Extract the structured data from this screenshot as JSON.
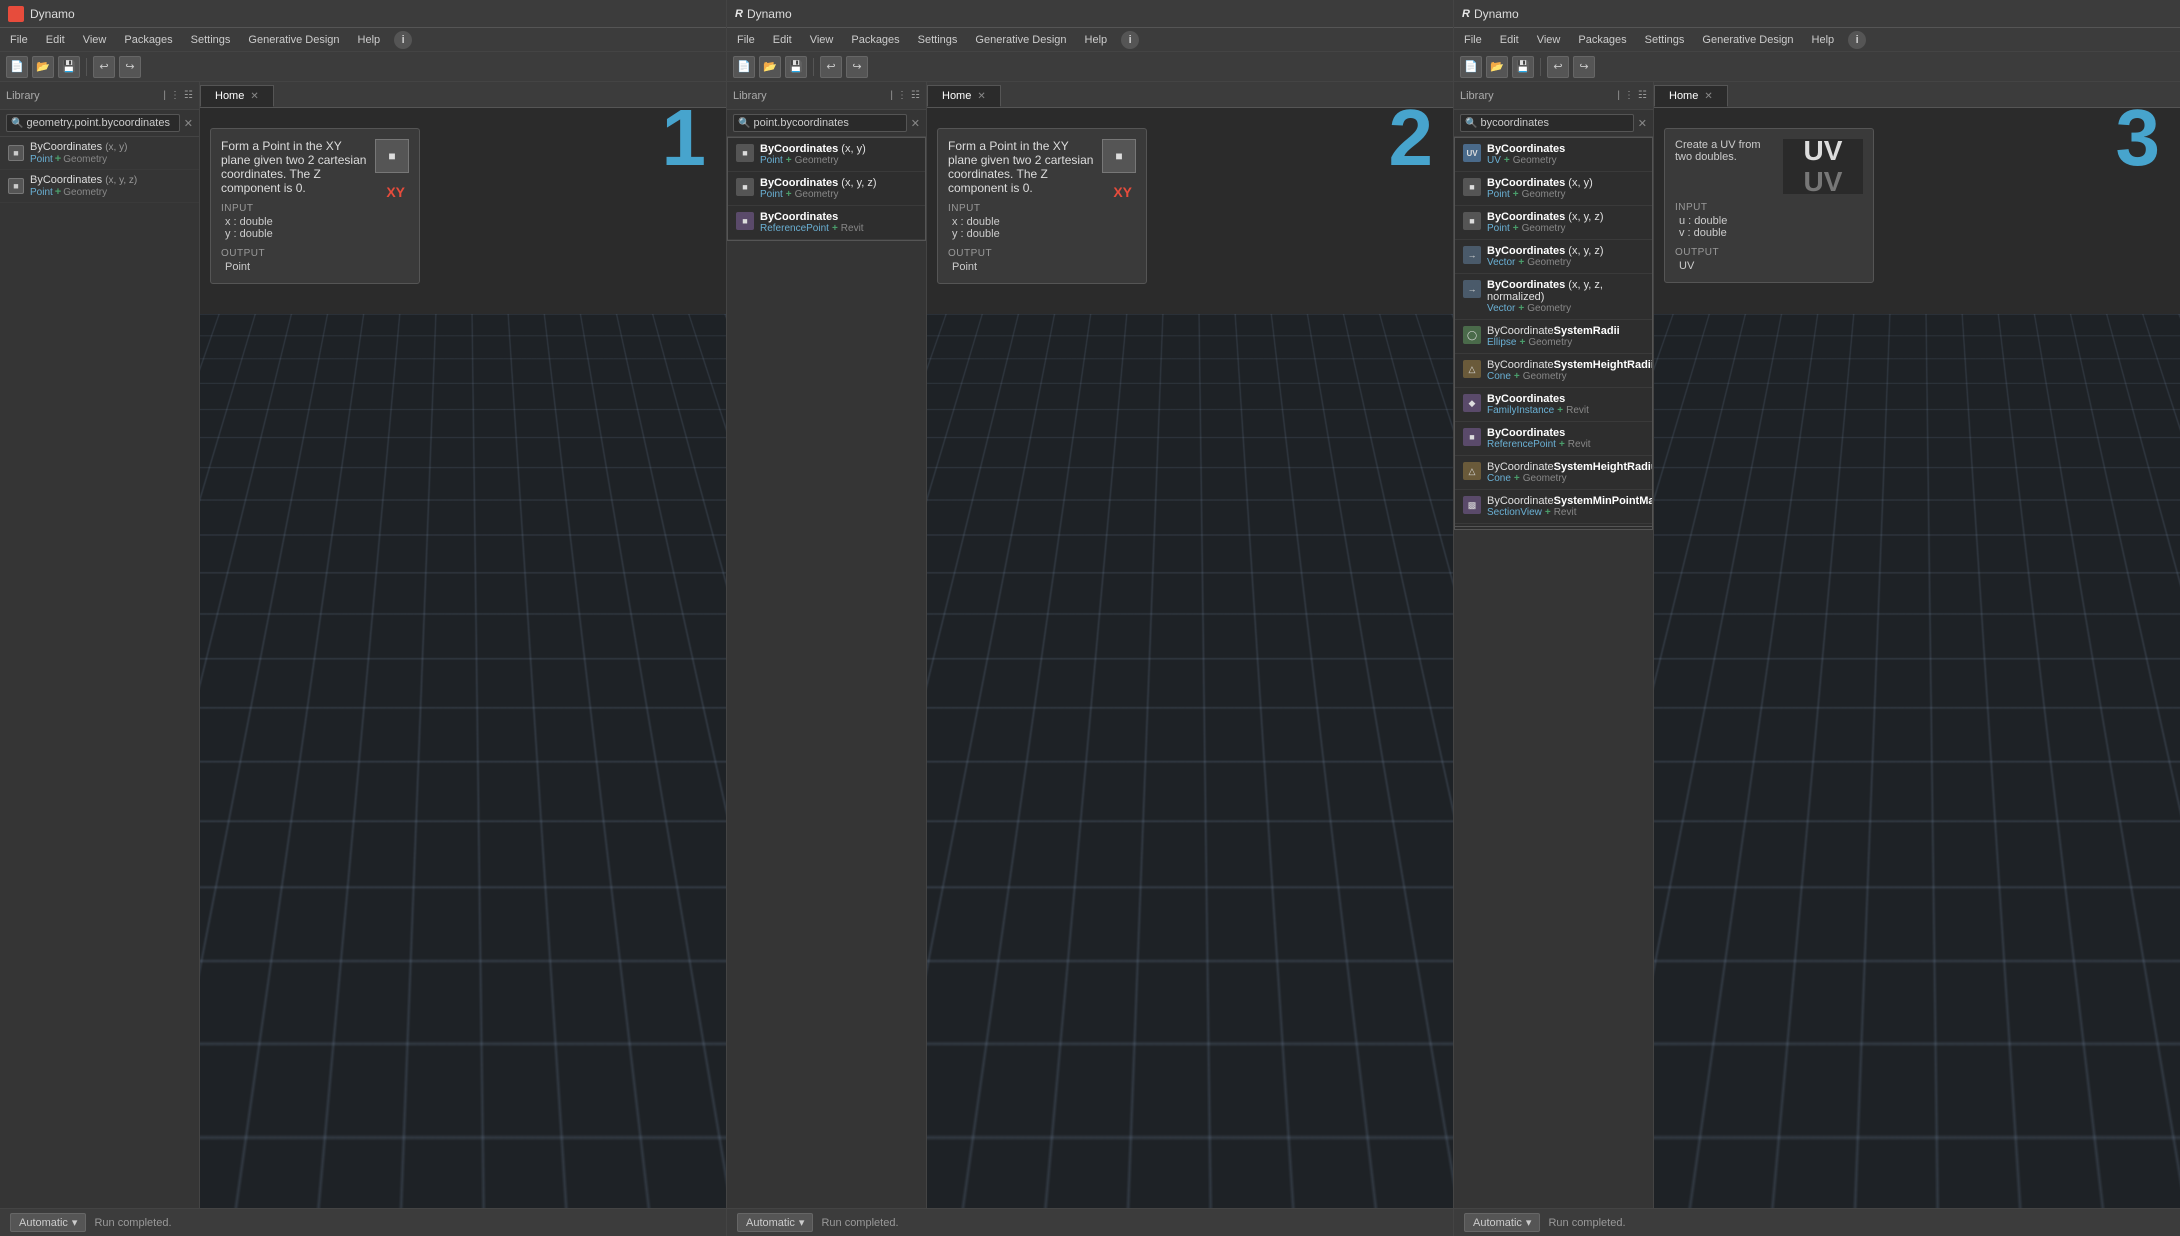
{
  "panels": [
    {
      "id": "panel1",
      "title": "Dynamo",
      "has_r": false,
      "menuItems": [
        "File",
        "Edit",
        "View",
        "Packages",
        "Settings",
        "Generative Design",
        "Help"
      ],
      "library": {
        "label": "Library",
        "searchValue": "geometry.point.bycoordinates",
        "items": [
          {
            "name": "ByCoordinates",
            "params": "(x, y)",
            "sub1": "Point",
            "sub2": "Geometry"
          },
          {
            "name": "ByCoordinates",
            "params": "(x, y, z)",
            "sub1": "Point",
            "sub2": "Geometry"
          }
        ]
      },
      "tab": "Home",
      "stepNumber": "1",
      "infoCard": {
        "description": "Form a Point in the XY plane given two 2 cartesian coordinates. The Z component is 0.",
        "inputLabel": "INPUT",
        "inputs": [
          "x : double",
          "y : double"
        ],
        "outputLabel": "OUTPUT",
        "outputs": [
          "Point"
        ],
        "showXY": true,
        "showUV": false
      },
      "status": "Automatic",
      "statusText": "Run completed."
    },
    {
      "id": "panel2",
      "title": "Dynamo",
      "has_r": true,
      "menuItems": [
        "File",
        "Edit",
        "View",
        "Packages",
        "Settings",
        "Generative Design",
        "Help"
      ],
      "library": {
        "label": "Library",
        "searchValue": "point.bycoordinates",
        "items": [
          {
            "name": "ByCoordinates",
            "params": "(x, y)",
            "sub1": "Point",
            "sub2": "Geometry",
            "iconType": "square"
          },
          {
            "name": "ByCoordinates",
            "params": "(x, y, z)",
            "sub1": "Point",
            "sub2": "Geometry",
            "iconType": "square"
          },
          {
            "name": "ByCoordinates",
            "params": "",
            "sub1": "ReferencePoint",
            "sub2": "Revit",
            "iconType": "small-square"
          }
        ]
      },
      "tab": "Home",
      "stepNumber": "2",
      "infoCard": {
        "description": "Form a Point in the XY plane given two 2 cartesian coordinates. The Z component is 0.",
        "inputLabel": "INPUT",
        "inputs": [
          "x : double",
          "y : double"
        ],
        "outputLabel": "OUTPUT",
        "outputs": [
          "Point"
        ],
        "showXY": true,
        "showUV": false
      },
      "status": "Automatic",
      "statusText": "Run completed."
    },
    {
      "id": "panel3",
      "title": "Dynamo",
      "has_r": true,
      "menuItems": [
        "File",
        "Edit",
        "View",
        "Packages",
        "Settings",
        "Generative Design",
        "Help"
      ],
      "library": {
        "label": "Library",
        "searchValue": "bycoordinates",
        "items": [
          {
            "name": "ByCoordinates",
            "params": "",
            "sub1": "UV",
            "sub2": "Geometry",
            "iconType": "uv"
          },
          {
            "name": "ByCoordinates",
            "params": "(x, y)",
            "sub1": "Point",
            "sub2": "Geometry",
            "iconType": "square"
          },
          {
            "name": "ByCoordinates",
            "params": "(x, y, z)",
            "sub1": "Point",
            "sub2": "Geometry",
            "iconType": "square"
          },
          {
            "name": "ByCoordinates",
            "params": "(x, y, z)",
            "sub1": "Vector",
            "sub2": "Geometry",
            "iconType": "vector"
          },
          {
            "name": "ByCoordinates",
            "params": "(x, y, z, normalized)",
            "sub1": "Vector",
            "sub2": "Geometry",
            "iconType": "vector"
          },
          {
            "name": "ByCoordinateSystemRadii",
            "params": "",
            "sub1": "Ellipse",
            "sub2": "Geometry",
            "iconType": "ellipse"
          },
          {
            "name": "ByCoordinateSystemHeightRadii",
            "params": "",
            "sub1": "Cone",
            "sub2": "Geometry",
            "iconType": "cone"
          },
          {
            "name": "ByCoordinates",
            "params": "",
            "sub1": "FamilyInstance",
            "sub2": "Revit",
            "iconType": "family"
          },
          {
            "name": "ByCoordinates",
            "params": "",
            "sub1": "ReferencePoint",
            "sub2": "Revit",
            "iconType": "refpoint"
          },
          {
            "name": "ByCoordinateSystemHeightRadius",
            "params": "",
            "sub1": "Cone",
            "sub2": "Geometry",
            "iconType": "cone2"
          },
          {
            "name": "ByCoordinateSystemMinPointMaxPoint",
            "params": "",
            "sub1": "SectionView",
            "sub2": "Revit",
            "iconType": "section"
          }
        ]
      },
      "tab": "Home",
      "stepNumber": "3",
      "infoCard": {
        "description": "Create a UV from two doubles.",
        "inputLabel": "INPUT",
        "inputs": [
          "u : double",
          "v : double"
        ],
        "outputLabel": "OUTPUT",
        "outputs": [
          "UV"
        ],
        "showXY": false,
        "showUV": true,
        "uvU": "UV",
        "uvV": "UV"
      },
      "status": "Automatic",
      "statusText": "Run completed."
    }
  ],
  "icons": {
    "search": "🔍",
    "close": "✕",
    "filter": "≡",
    "grid": "⊞",
    "chevron": "▾",
    "new": "📄",
    "open": "📂",
    "save": "💾",
    "undo": "↩",
    "redo": "↪"
  }
}
